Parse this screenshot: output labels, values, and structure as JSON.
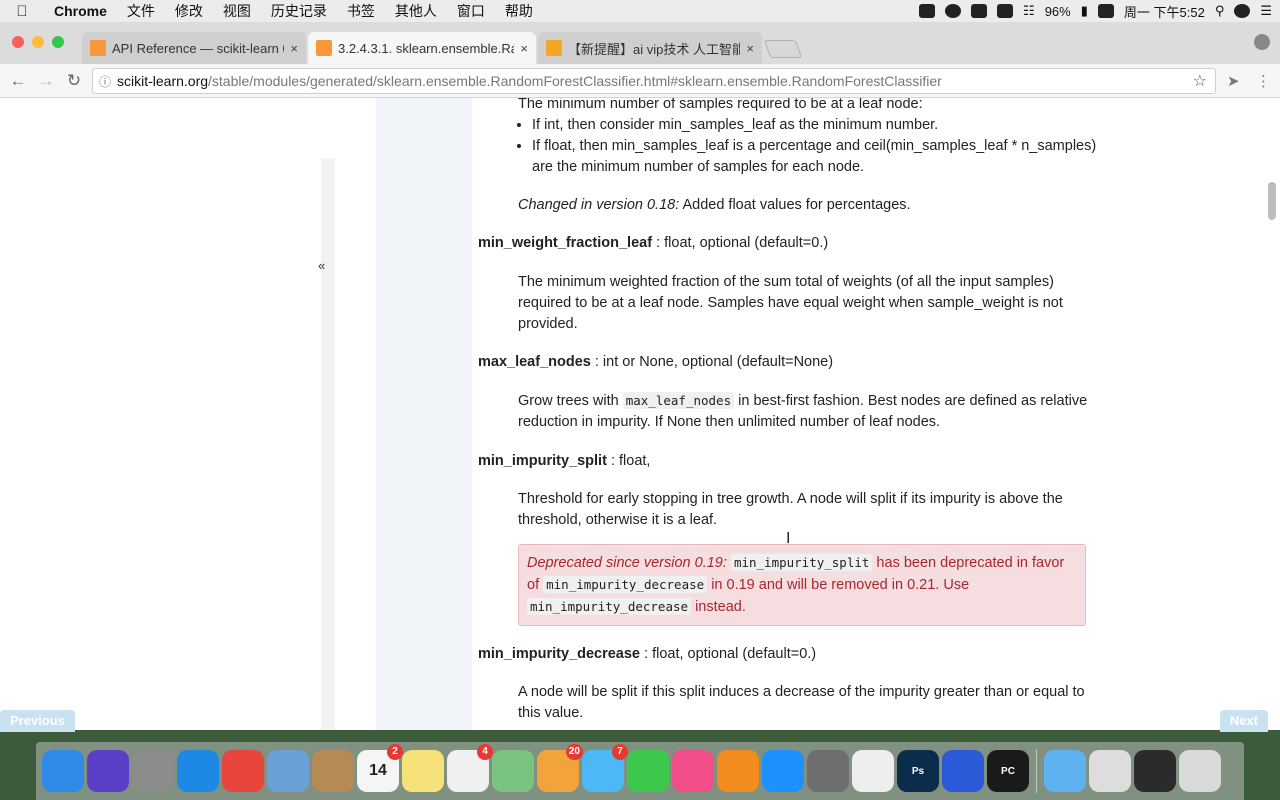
{
  "menubar": {
    "app_name": "Chrome",
    "items": [
      "文件",
      "修改",
      "视图",
      "历史记录",
      "书签",
      "其他人",
      "窗口",
      "帮助"
    ],
    "battery": "96%",
    "clock": "周一 下午5:52"
  },
  "tabs": [
    {
      "title": "API Reference — scikit-learn 0.",
      "favicon_color": "#f89939",
      "close": "×"
    },
    {
      "title": "3.2.4.3.1. sklearn.ensemble.Ra",
      "favicon_color": "#f89939",
      "close": "×"
    },
    {
      "title": "【新提醒】ai vip技术 人工智能",
      "favicon_color": "#f5a623",
      "close": "×"
    }
  ],
  "address": {
    "host": "scikit-learn.org",
    "path": "/stable/modules/generated/sklearn.ensemble.RandomForestClassifier.html#sklearn.ensemble.RandomForestClassifier"
  },
  "sidebar": {
    "collapse_label": "«"
  },
  "doc": {
    "leaf_intro": "The minimum number of samples required to be at a leaf node:",
    "leaf_bullet1": "If int, then consider min_samples_leaf as the minimum number.",
    "leaf_bullet2": "If float, then min_samples_leaf is a percentage and ceil(min_samples_leaf * n_samples) are the minimum number of samples for each node.",
    "leaf_changed_em": "Changed in version 0.18:",
    "leaf_changed_text": " Added float values for percentages.",
    "mwfl_name": "min_weight_fraction_leaf",
    "mwfl_type": " : float, optional (default=0.)",
    "mwfl_desc": "The minimum weighted fraction of the sum total of weights (of all the input samples) required to be at a leaf node. Samples have equal weight when sample_weight is not provided.",
    "mln_name": "max_leaf_nodes",
    "mln_type": " : int or None, optional (default=None)",
    "mln_desc_a": "Grow trees with ",
    "mln_code": "max_leaf_nodes",
    "mln_desc_b": " in best-first fashion. Best nodes are defined as relative reduction in impurity. If None then unlimited number of leaf nodes.",
    "mis_name": "min_impurity_split",
    "mis_type": " : float,",
    "mis_desc": "Threshold for early stopping in tree growth. A node will split if its impurity is above the threshold, otherwise it is a leaf.",
    "dep_em": "Deprecated since version 0.19:",
    "dep_code1": "min_impurity_split",
    "dep_text1": " has been deprecated in favor of ",
    "dep_code2": "min_impurity_decrease",
    "dep_text2": " in 0.19 and will be removed in 0.21. Use ",
    "dep_code3": "min_impurity_decrease",
    "dep_text3": " instead.",
    "mid_name": "min_impurity_decrease",
    "mid_type": " : float, optional (default=0.)",
    "mid_desc": "A node will be split if this split induces a decrease of the impurity greater than or equal to this value."
  },
  "pager": {
    "previous": "Previous",
    "next": "Next"
  },
  "dock": [
    {
      "name": "finder",
      "color": "#2f8ae8"
    },
    {
      "name": "siri",
      "color": "#5b3fc8"
    },
    {
      "name": "launchpad",
      "color": "#8c8c8c"
    },
    {
      "name": "safari",
      "color": "#1e88e5"
    },
    {
      "name": "chrome",
      "color": "#e8453c"
    },
    {
      "name": "mail",
      "color": "#6aa0d8"
    },
    {
      "name": "contacts",
      "color": "#b58a55"
    },
    {
      "name": "calendar",
      "color": "#f5f5f5",
      "label": "14",
      "badge": "2"
    },
    {
      "name": "notes",
      "color": "#f7e27a"
    },
    {
      "name": "reminders",
      "color": "#f0f0f0",
      "badge": "4"
    },
    {
      "name": "maps",
      "color": "#7bc47f"
    },
    {
      "name": "photos",
      "color": "#f2a33b",
      "badge": "20"
    },
    {
      "name": "messages",
      "color": "#4cb8f5",
      "badge": "7"
    },
    {
      "name": "facetime",
      "color": "#3cc84b"
    },
    {
      "name": "itunes",
      "color": "#f04e88"
    },
    {
      "name": "ibooks",
      "color": "#f28c1e"
    },
    {
      "name": "app-store",
      "color": "#1e90ff"
    },
    {
      "name": "system-preferences",
      "color": "#6e6e6e"
    },
    {
      "name": "textedit",
      "color": "#eeeeee"
    },
    {
      "name": "photoshop",
      "color": "#0b2c4a",
      "label": "Ps"
    },
    {
      "name": "video-app",
      "color": "#2a5ad8"
    },
    {
      "name": "pycharm",
      "color": "#1a1a1a",
      "label": "PC"
    },
    {
      "name": "folder",
      "color": "#5fb2f0"
    },
    {
      "name": "window-preview",
      "color": "#dddddd"
    },
    {
      "name": "terminal",
      "color": "#2b2b2b"
    },
    {
      "name": "trash",
      "color": "#d9d9d9"
    }
  ]
}
